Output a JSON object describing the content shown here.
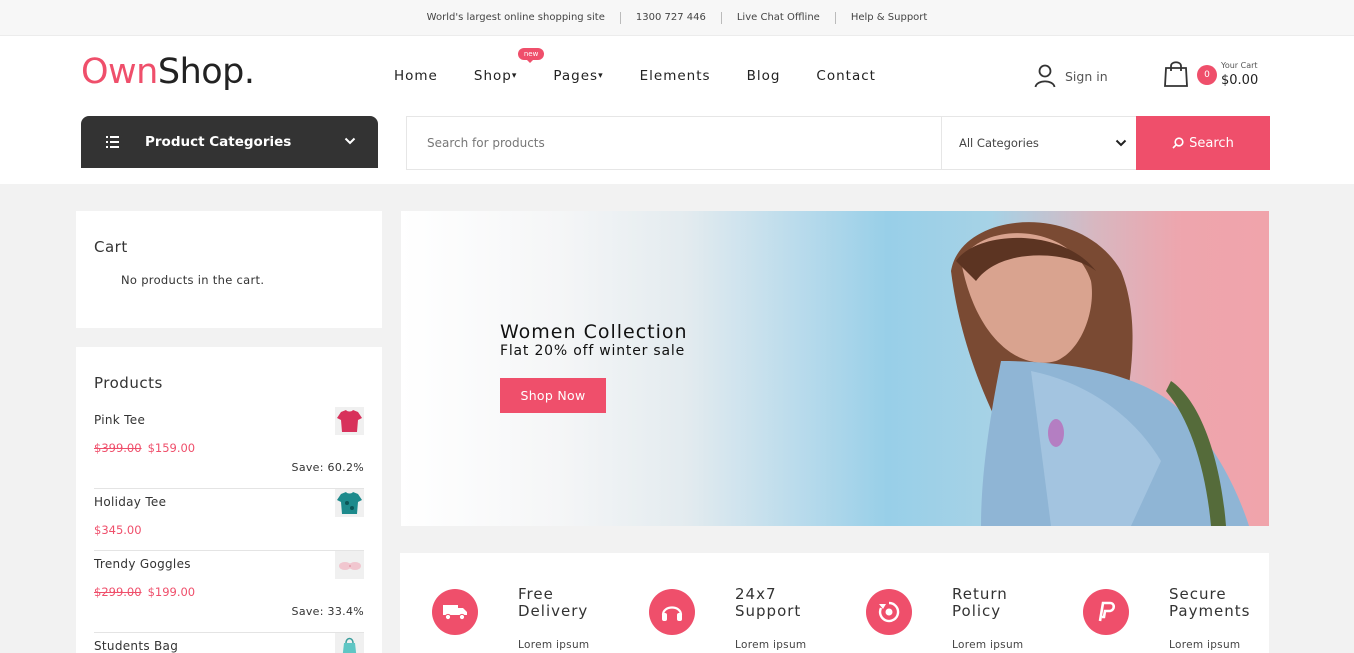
{
  "topbar": {
    "items": [
      "World's largest online shopping site",
      "1300 727 446",
      "Live Chat Offline",
      "Help & Support"
    ]
  },
  "logo": {
    "part1": "Own",
    "part2": "Shop."
  },
  "nav": {
    "items": [
      {
        "label": "Home",
        "caret": ""
      },
      {
        "label": "Shop",
        "caret": "▾"
      },
      {
        "label": "Pages",
        "caret": "▾"
      },
      {
        "label": "Elements",
        "caret": ""
      },
      {
        "label": "Blog",
        "caret": ""
      },
      {
        "label": "Contact",
        "caret": ""
      }
    ],
    "new_badge": "new"
  },
  "account": {
    "sign_in_label": "Sign in"
  },
  "cart_header": {
    "count": "0",
    "label": "Your Cart",
    "total": "$0.00"
  },
  "categories_button": {
    "label": "Product Categories"
  },
  "search": {
    "placeholder": "Search for products",
    "category_selected": "All Categories",
    "button_label": "Search"
  },
  "cart_widget": {
    "title": "Cart",
    "empty_message": "No products in the cart."
  },
  "products_widget": {
    "title": "Products",
    "items": [
      {
        "name": "Pink Tee",
        "old_price": "$399.00",
        "price": "$159.00",
        "save": "Save: 60.2%",
        "thumb_color": "#d8315b"
      },
      {
        "name": "Holiday Tee",
        "old_price": "",
        "price": "$345.00",
        "save": "",
        "thumb_color": "#1d8a8c"
      },
      {
        "name": "Trendy Goggles",
        "old_price": "$299.00",
        "price": "$199.00",
        "save": "Save: 33.4%",
        "thumb_color": "#f1c6cf"
      },
      {
        "name": "Students Bag",
        "old_price": "",
        "price": "",
        "save": "",
        "thumb_color": "#5fc6c4"
      }
    ]
  },
  "banner": {
    "headline": "Women Collection",
    "subheadline": "Flat 20% off winter sale",
    "button_label": "Shop Now"
  },
  "features": [
    {
      "title_line1": "Free",
      "title_line2": "Delivery",
      "desc": "Lorem ipsum",
      "icon": "truck-icon"
    },
    {
      "title_line1": "24x7",
      "title_line2": "Support",
      "desc": "Lorem ipsum",
      "icon": "headphones-icon"
    },
    {
      "title_line1": "Return",
      "title_line2": "Policy",
      "desc": "Lorem ipsum",
      "icon": "return-icon"
    },
    {
      "title_line1": "Secure",
      "title_line2": "Payments",
      "desc": "Lorem ipsum",
      "icon": "paypal-icon"
    }
  ],
  "colors": {
    "accent": "#ef4f6b",
    "dark": "#333333"
  }
}
